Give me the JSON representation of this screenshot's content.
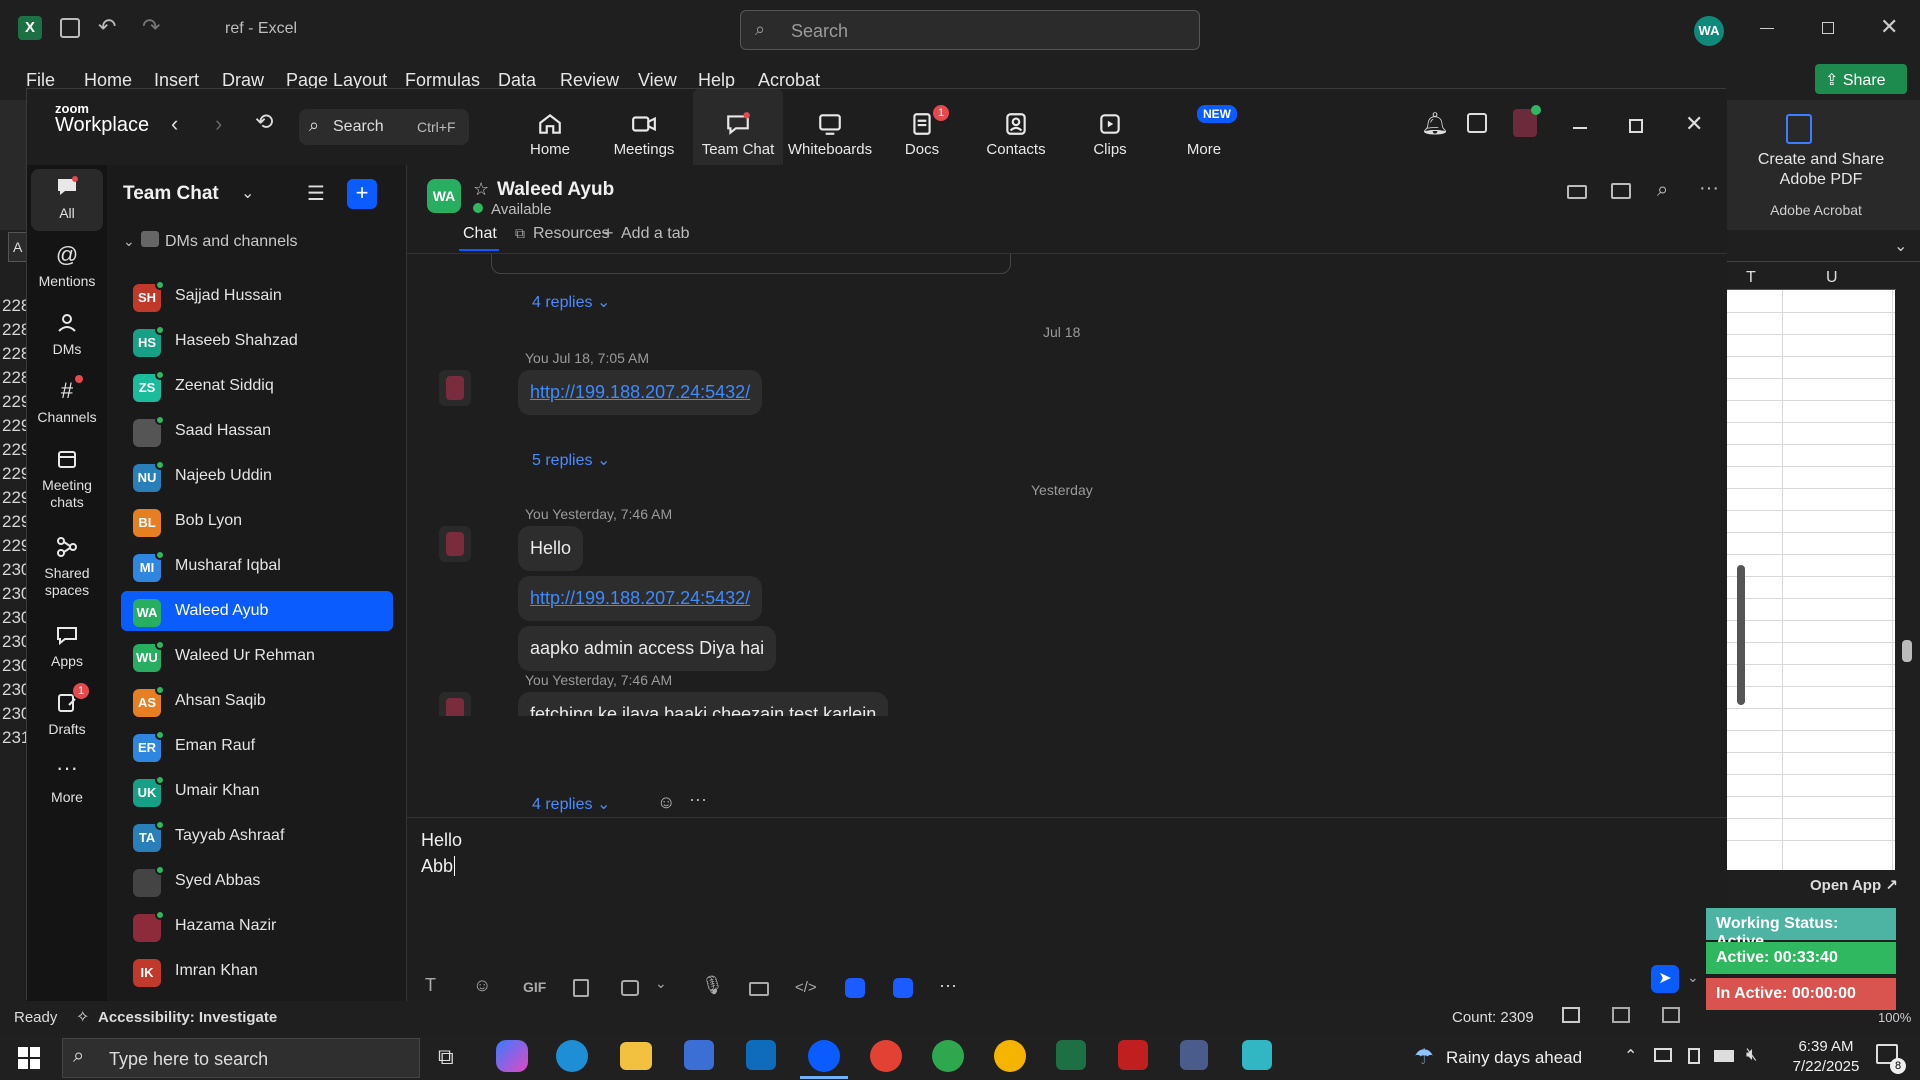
{
  "excel": {
    "title": "ref  -  Excel",
    "search_placeholder": "Search",
    "user_initials": "WA",
    "menu": [
      "File",
      "Home",
      "Insert",
      "Draw",
      "Page Layout",
      "Formulas",
      "Data",
      "Review",
      "View",
      "Help",
      "Acrobat"
    ],
    "share_label": "Share",
    "row_numbers": [
      "228",
      "228",
      "228",
      "228",
      "229",
      "229",
      "229",
      "229",
      "229",
      "229",
      "229",
      "230",
      "230",
      "230",
      "230",
      "230",
      "230",
      "230",
      "231"
    ],
    "columns": [
      "T",
      "U"
    ],
    "status": {
      "ready": "Ready",
      "accessibility": "Accessibility: Investigate",
      "count": "Count: 2309",
      "zoom": "100%"
    },
    "adobe": {
      "create_share": "Create and Share Adobe PDF",
      "group_label": "Adobe Acrobat"
    },
    "cell_ref_partial": "A"
  },
  "zoom": {
    "brand_top": "zoom",
    "brand_bottom": "Workplace",
    "search_label": "Search",
    "search_shortcut": "Ctrl+F",
    "topnav": [
      {
        "label": "Home",
        "icon": "home-icon",
        "badge": ""
      },
      {
        "label": "Meetings",
        "icon": "camera-icon",
        "badge": ""
      },
      {
        "label": "Team Chat",
        "icon": "chat-icon",
        "badge": ""
      },
      {
        "label": "Whiteboards",
        "icon": "whiteboard-icon",
        "badge": ""
      },
      {
        "label": "Docs",
        "icon": "docs-icon",
        "badge": "1"
      },
      {
        "label": "Contacts",
        "icon": "contacts-icon",
        "badge": ""
      },
      {
        "label": "Clips",
        "icon": "clips-icon",
        "badge": ""
      },
      {
        "label": "More",
        "icon": "more-icon",
        "badge": "NEW"
      }
    ],
    "rail": [
      {
        "label": "All",
        "icon": "chat-bubble-icon"
      },
      {
        "label": "Mentions",
        "icon": "at-icon"
      },
      {
        "label": "DMs",
        "icon": "people-icon"
      },
      {
        "label": "Channels",
        "icon": "hash-icon"
      },
      {
        "label": "Meeting chats",
        "icon": "calendar-icon"
      },
      {
        "label": "Shared spaces",
        "icon": "share-icon"
      },
      {
        "label": "Apps",
        "icon": "apps-icon"
      },
      {
        "label": "Drafts",
        "icon": "drafts-icon",
        "badge": "1"
      },
      {
        "label": "More",
        "icon": "ellipsis-icon"
      }
    ],
    "list_title": "Team Chat",
    "section_label": "DMs and channels",
    "contacts": [
      {
        "initials": "SH",
        "name": "Sajjad Hussain",
        "color": "#c0392b"
      },
      {
        "initials": "HS",
        "name": "Haseeb Shahzad",
        "color": "#16a085"
      },
      {
        "initials": "ZS",
        "name": "Zeenat Siddiq",
        "color": "#1abc9c"
      },
      {
        "initials": "",
        "name": "Saad Hassan",
        "color": "#555555"
      },
      {
        "initials": "NU",
        "name": "Najeeb Uddin",
        "color": "#2980b9"
      },
      {
        "initials": "BL",
        "name": "Bob Lyon",
        "color": "#e67e22"
      },
      {
        "initials": "MI",
        "name": "Musharaf Iqbal",
        "color": "#2e86de"
      },
      {
        "initials": "WA",
        "name": "Waleed Ayub",
        "color": "#27ae60"
      },
      {
        "initials": "WU",
        "name": "Waleed Ur Rehman",
        "color": "#27ae60"
      },
      {
        "initials": "AS",
        "name": "Ahsan Saqib",
        "color": "#e67e22"
      },
      {
        "initials": "ER",
        "name": "Eman Rauf",
        "color": "#2e86de"
      },
      {
        "initials": "UK",
        "name": "Umair Khan",
        "color": "#16a085"
      },
      {
        "initials": "TA",
        "name": "Tayyab Ashraaf",
        "color": "#2980b9"
      },
      {
        "initials": "",
        "name": "Syed Abbas",
        "color": "#444444"
      },
      {
        "initials": "",
        "name": "Hazama Nazir",
        "color": "#8e2b3a"
      },
      {
        "initials": "IK",
        "name": "Imran Khan",
        "color": "#c0392b"
      }
    ],
    "chat": {
      "header_initials": "WA",
      "header_name": "Waleed Ayub",
      "header_status": "Available",
      "tabs": [
        "Chat",
        "Resources",
        "Add a tab"
      ],
      "messages": [
        {
          "replies": "4 replies"
        },
        {
          "date": "Jul 18"
        },
        {
          "meta": "You  Jul 18, 7:05 AM",
          "link": "http://199.188.207.24:5432/",
          "replies": "5 replies"
        },
        {
          "date": "Yesterday"
        },
        {
          "meta": "You  Yesterday, 7:46 AM",
          "text1": "Hello",
          "link": "http://199.188.207.24:5432/",
          "text2": "aapko admin access Diya hai"
        },
        {
          "meta": "You  Yesterday, 7:46 AM",
          "text": "fetching ke ilava baaki cheezain test karlein",
          "replies": "4 replies"
        }
      ],
      "compose_line1": "Hello",
      "compose_line2": "Abb"
    }
  },
  "widgets": {
    "open_app": "Open App ↗",
    "working_status": "Working Status: Active",
    "active": "Active: 00:33:40",
    "inactive": "In Active: 00:00:00"
  },
  "taskbar": {
    "search_placeholder": "Type here to search",
    "weather": "Rainy days ahead",
    "time": "6:39 AM",
    "date": "7/22/2025",
    "notification_count": "8"
  }
}
